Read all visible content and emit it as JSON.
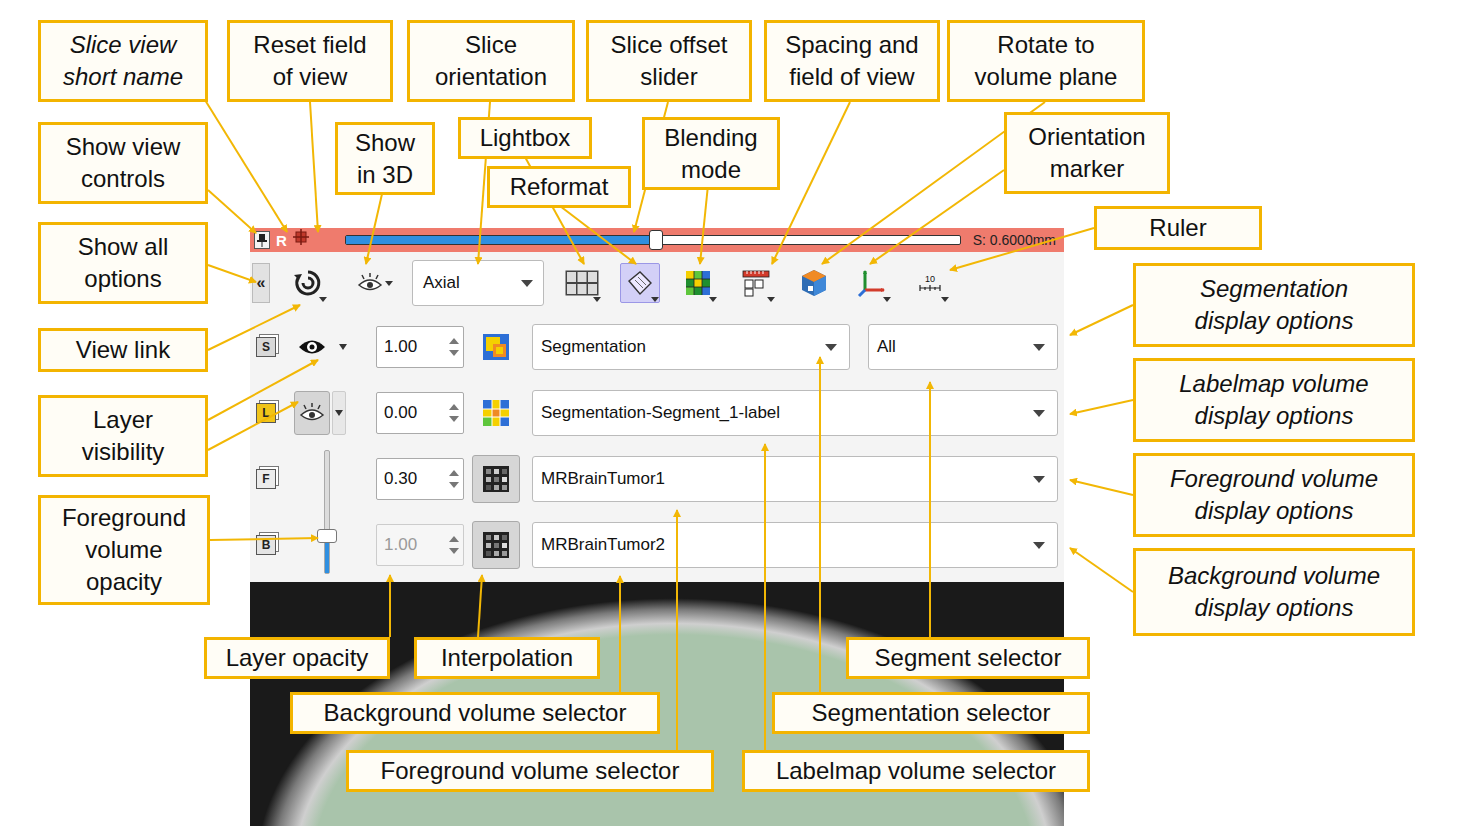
{
  "callouts": [
    {
      "text": "Slice view short name",
      "italic": true
    },
    {
      "text": "Reset field of view",
      "italic": false
    },
    {
      "text": "Slice orientation",
      "italic": false
    },
    {
      "text": "Slice offset slider",
      "italic": false
    },
    {
      "text": "Spacing and field of view",
      "italic": false
    },
    {
      "text": "Rotate to volume plane",
      "italic": false
    },
    {
      "text": "Show view controls",
      "italic": false
    },
    {
      "text": "Show in 3D",
      "italic": false
    },
    {
      "text": "Lightbox",
      "italic": false
    },
    {
      "text": "Blending mode",
      "italic": false
    },
    {
      "text": "Orientation marker",
      "italic": false
    },
    {
      "text": "Reformat",
      "italic": false
    },
    {
      "text": "Ruler",
      "italic": false
    },
    {
      "text": "Show all options",
      "italic": false
    },
    {
      "text": "Segmentation display options",
      "italic": true
    },
    {
      "text": "View link",
      "italic": false
    },
    {
      "text": "Layer visibility",
      "italic": false
    },
    {
      "text": "Labelmap volume display options",
      "italic": true
    },
    {
      "text": "Foreground volume display options",
      "italic": true
    },
    {
      "text": "Foreground volume opacity",
      "italic": false
    },
    {
      "text": "Background volume display options",
      "italic": true
    },
    {
      "text": "Layer opacity",
      "italic": false
    },
    {
      "text": "Interpolation",
      "italic": false
    },
    {
      "text": "Segment selector",
      "italic": false
    },
    {
      "text": "Background volume selector",
      "italic": false
    },
    {
      "text": "Segmentation selector",
      "italic": false
    },
    {
      "text": "Foreground volume selector",
      "italic": false
    },
    {
      "text": "Labelmap volume selector",
      "italic": false
    }
  ],
  "view": {
    "short_name": "R",
    "show_all": "«",
    "orientation": "Axial",
    "offset": {
      "level": 0.505,
      "reading": "S: 0.6000mm"
    }
  },
  "tools": [
    {
      "kind": "link",
      "selected": false
    },
    {
      "kind": "show3d",
      "selected": false
    },
    {
      "kind": "lightbox",
      "selected": false
    },
    {
      "kind": "reformat",
      "selected": true
    },
    {
      "kind": "blending",
      "selected": false
    },
    {
      "kind": "spacing",
      "selected": false
    },
    {
      "kind": "rotate",
      "selected": false
    },
    {
      "kind": "marker",
      "selected": false
    },
    {
      "kind": "ruler",
      "selected": false,
      "text": "10"
    }
  ],
  "layers": [
    {
      "badge": "S",
      "kind": "segmentation",
      "visible": true,
      "opacity": "1.00",
      "disabled": false,
      "node": "Segmentation",
      "segment": "All"
    },
    {
      "badge": "L",
      "kind": "labelmap",
      "visible": true,
      "opacity": "0.00",
      "disabled": false,
      "node": "Segmentation-Segment_1-label"
    },
    {
      "badge": "F",
      "kind": "foreground",
      "interpolate": true,
      "opacity": "0.30",
      "disabled": false,
      "node": "MRBrainTumor1"
    },
    {
      "badge": "B",
      "kind": "background",
      "interpolate": true,
      "opacity": "1.00",
      "disabled": true,
      "node": "MRBrainTumor2"
    }
  ],
  "foreground_opacity": {
    "level": 0.3
  }
}
